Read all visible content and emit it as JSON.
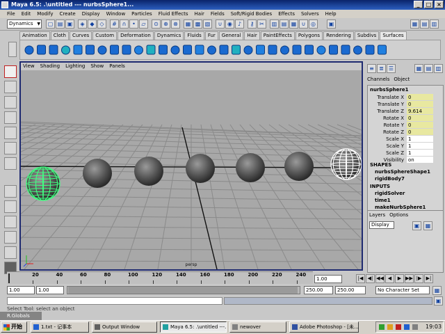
{
  "window": {
    "title": "Maya 6.5: .\\untitled   ---   nurbsSphere1...",
    "min": "_",
    "max": "□",
    "close": "×"
  },
  "menus": [
    "File",
    "Edit",
    "Modify",
    "Create",
    "Display",
    "Window",
    "Particles",
    "Fluid Effects",
    "Hair",
    "Fields",
    "Soft/Rigid Bodies",
    "Effects",
    "Solvers",
    "Help"
  ],
  "mode_selector": "Dynamics",
  "shelf_tabs": [
    "Animation",
    "Cloth",
    "Curves",
    "Custom",
    "Deformation",
    "Dynamics",
    "Fluids",
    "Fur",
    "General",
    "Hair",
    "PaintEffects",
    "Polygons",
    "Rendering",
    "Subdivs",
    "Surfaces"
  ],
  "active_shelf_tab": "Surfaces",
  "viewport": {
    "menus": [
      "View",
      "Shading",
      "Lighting",
      "Show",
      "Panels"
    ],
    "camera_label": "persp"
  },
  "channel_box": {
    "tabs": [
      "Channels",
      "Object"
    ],
    "object_name": "nurbsSphere1",
    "attributes": [
      {
        "label": "Translate X",
        "value": "0",
        "highlight": true
      },
      {
        "label": "Translate Y",
        "value": "0",
        "highlight": true
      },
      {
        "label": "Translate Z",
        "value": "9.614",
        "highlight": true
      },
      {
        "label": "Rotate X",
        "value": "0",
        "highlight": true
      },
      {
        "label": "Rotate Y",
        "value": "0",
        "highlight": true
      },
      {
        "label": "Rotate Z",
        "value": "0",
        "highlight": true
      },
      {
        "label": "Scale X",
        "value": "1",
        "highlight": false
      },
      {
        "label": "Scale Y",
        "value": "1",
        "highlight": false
      },
      {
        "label": "Scale Z",
        "value": "1",
        "highlight": false
      },
      {
        "label": "Visibility",
        "value": "on",
        "highlight": false
      }
    ],
    "shapes_header": "SHAPES",
    "shapes": [
      "nurbsSphereShape1",
      "rigidBody7"
    ],
    "inputs_header": "INPUTS",
    "inputs": [
      "rigidSolver",
      "time1",
      "makeNurbSphere1"
    ]
  },
  "layers": {
    "tabs": [
      "Layers",
      "Options"
    ],
    "display": "Display"
  },
  "timeline": {
    "ticks": [
      "20",
      "40",
      "60",
      "80",
      "100",
      "120",
      "140",
      "160",
      "180",
      "200",
      "220",
      "240"
    ],
    "current_time": "1.00",
    "playback_buttons": [
      "|◀",
      "◀|",
      "◀◀",
      "◀",
      "▶",
      "▶▶",
      "|▶",
      "▶|"
    ]
  },
  "range": {
    "start": "1.00",
    "playback_start": "1.00",
    "playback_end": "250.00",
    "end": "250.00",
    "character_set": "No Character Set"
  },
  "help_line": "Select Tool: select an object",
  "floating_window": "R.Globals",
  "taskbar": {
    "start": "开始",
    "items": [
      "1.txt - 记事本",
      "Output Window",
      "Maya 6.5: .\\untitled   ---...",
      "newover",
      "Adobe Photoshop - [未..."
    ],
    "active_index": 2,
    "clock": "19:03"
  },
  "colors": {
    "title_bar": "#0a246a",
    "viewport_bg": "#a8a8a8",
    "selected_wire": "#40ff80",
    "highlight_field": "#e8e8a0"
  }
}
